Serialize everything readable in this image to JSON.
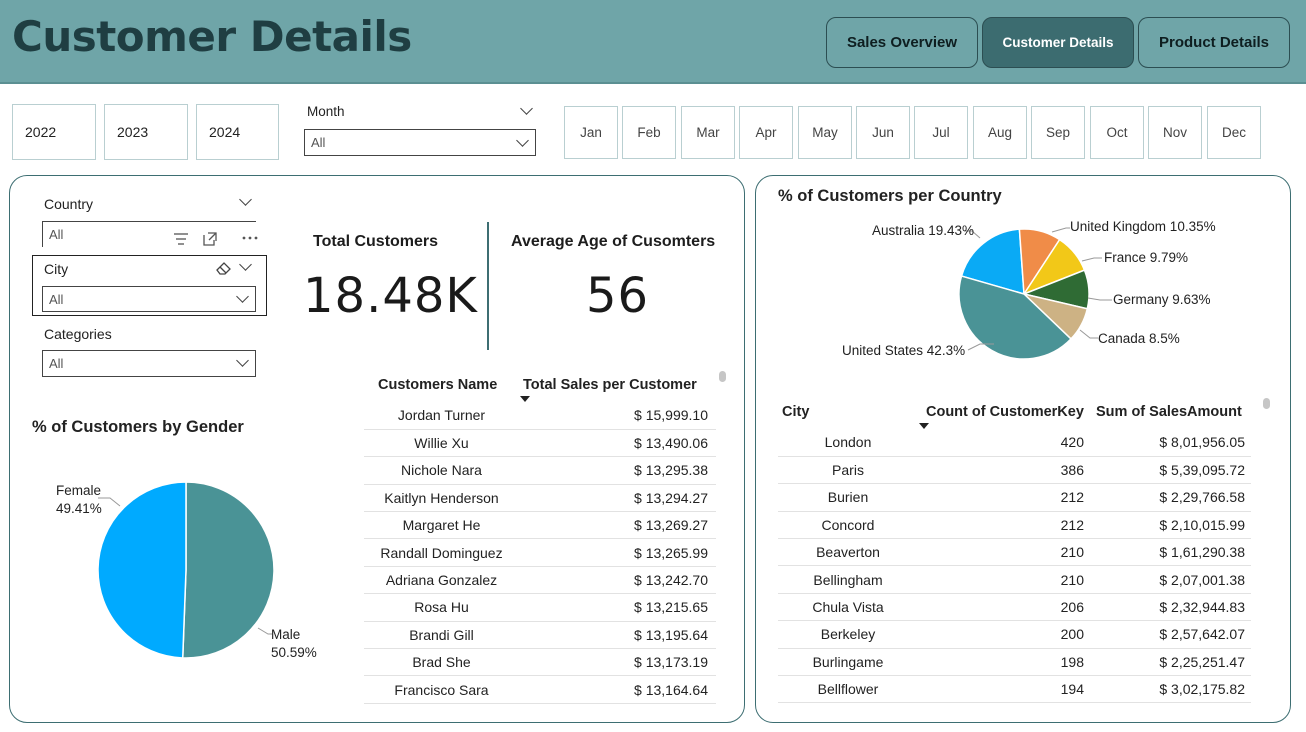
{
  "header": {
    "title": "Customer Details",
    "nav": [
      {
        "label": "Sales Overview",
        "active": false
      },
      {
        "label": "Customer Details",
        "active": true
      },
      {
        "label": "Product Details",
        "active": false
      }
    ]
  },
  "filters": {
    "years": [
      "2022",
      "2023",
      "2024"
    ],
    "month_label": "Month",
    "month_value": "All",
    "months": [
      "Jan",
      "Feb",
      "Mar",
      "Apr",
      "May",
      "Jun",
      "Jul",
      "Aug",
      "Sep",
      "Oct",
      "Nov",
      "Dec"
    ]
  },
  "slicers": {
    "country": {
      "label": "Country",
      "value": "All"
    },
    "city": {
      "label": "City",
      "value": "All"
    },
    "categories": {
      "label": "Categories",
      "value": "All"
    }
  },
  "kpis": {
    "total_customers": {
      "label": "Total Customers",
      "value": "18.48K"
    },
    "average_age": {
      "label": "Average Age of Cusomters",
      "value": "56"
    }
  },
  "customers_table": {
    "headers": [
      "Customers Name",
      "Total Sales per Customer"
    ],
    "rows": [
      [
        "Jordan Turner",
        "$ 15,999.10"
      ],
      [
        "Willie Xu",
        "$ 13,490.06"
      ],
      [
        "Nichole Nara",
        "$ 13,295.38"
      ],
      [
        "Kaitlyn Henderson",
        "$ 13,294.27"
      ],
      [
        "Margaret He",
        "$ 13,269.27"
      ],
      [
        "Randall Dominguez",
        "$ 13,265.99"
      ],
      [
        "Adriana Gonzalez",
        "$ 13,242.70"
      ],
      [
        "Rosa Hu",
        "$ 13,215.65"
      ],
      [
        "Brandi Gill",
        "$ 13,195.64"
      ],
      [
        "Brad She",
        "$ 13,173.19"
      ],
      [
        "Francisco Sara",
        "$ 13,164.64"
      ]
    ]
  },
  "gender_chart": {
    "title": "% of Customers by Gender",
    "slices": [
      {
        "name": "Female",
        "pct": "49.41%",
        "value": 49.41,
        "color": "#00aaff"
      },
      {
        "name": "Male",
        "pct": "50.59%",
        "value": 50.59,
        "color": "#4a9396"
      }
    ]
  },
  "country_chart": {
    "title": "% of Customers per Country",
    "slices": [
      {
        "name": "Australia",
        "label": "Australia 19.43%",
        "value": 19.43,
        "color": "#0aaaf5"
      },
      {
        "name": "United Kingdom",
        "label": "United Kingdom 10.35%",
        "value": 10.35,
        "color": "#f08c48"
      },
      {
        "name": "France",
        "label": "France 9.79%",
        "value": 9.79,
        "color": "#f2c818"
      },
      {
        "name": "Germany",
        "label": "Germany 9.63%",
        "value": 9.63,
        "color": "#2f6b34"
      },
      {
        "name": "Canada",
        "label": "Canada 8.5%",
        "value": 8.5,
        "color": "#cdb284"
      },
      {
        "name": "United States",
        "label": "United States 42.3%",
        "value": 42.3,
        "color": "#4a9396"
      }
    ]
  },
  "city_table": {
    "headers": [
      "City",
      "Count of CustomerKey",
      "Sum of SalesAmount"
    ],
    "rows": [
      [
        "London",
        "420",
        "$ 8,01,956.05"
      ],
      [
        "Paris",
        "386",
        "$ 5,39,095.72"
      ],
      [
        "Burien",
        "212",
        "$ 2,29,766.58"
      ],
      [
        "Concord",
        "212",
        "$ 2,10,015.99"
      ],
      [
        "Beaverton",
        "210",
        "$ 1,61,290.38"
      ],
      [
        "Bellingham",
        "210",
        "$ 2,07,001.38"
      ],
      [
        "Chula Vista",
        "206",
        "$ 2,32,944.83"
      ],
      [
        "Berkeley",
        "200",
        "$ 2,57,642.07"
      ],
      [
        "Burlingame",
        "198",
        "$ 2,25,251.47"
      ],
      [
        "Bellflower",
        "194",
        "$ 3,02,175.82"
      ]
    ]
  }
}
